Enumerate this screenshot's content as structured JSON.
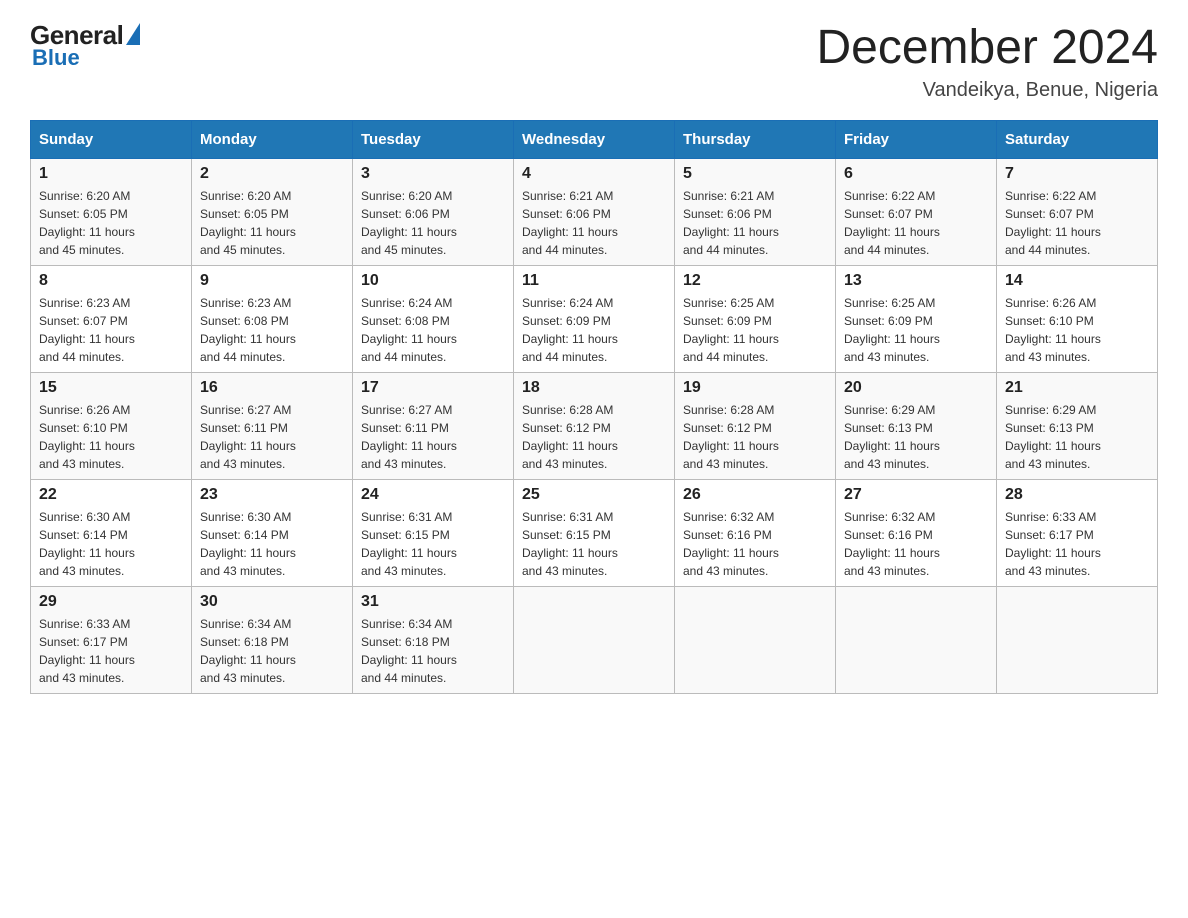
{
  "logo": {
    "general": "General",
    "blue": "Blue"
  },
  "header": {
    "month": "December 2024",
    "location": "Vandeikya, Benue, Nigeria"
  },
  "days_of_week": [
    "Sunday",
    "Monday",
    "Tuesday",
    "Wednesday",
    "Thursday",
    "Friday",
    "Saturday"
  ],
  "weeks": [
    [
      {
        "day": "1",
        "sunrise": "6:20 AM",
        "sunset": "6:05 PM",
        "daylight": "11 hours and 45 minutes."
      },
      {
        "day": "2",
        "sunrise": "6:20 AM",
        "sunset": "6:05 PM",
        "daylight": "11 hours and 45 minutes."
      },
      {
        "day": "3",
        "sunrise": "6:20 AM",
        "sunset": "6:06 PM",
        "daylight": "11 hours and 45 minutes."
      },
      {
        "day": "4",
        "sunrise": "6:21 AM",
        "sunset": "6:06 PM",
        "daylight": "11 hours and 44 minutes."
      },
      {
        "day": "5",
        "sunrise": "6:21 AM",
        "sunset": "6:06 PM",
        "daylight": "11 hours and 44 minutes."
      },
      {
        "day": "6",
        "sunrise": "6:22 AM",
        "sunset": "6:07 PM",
        "daylight": "11 hours and 44 minutes."
      },
      {
        "day": "7",
        "sunrise": "6:22 AM",
        "sunset": "6:07 PM",
        "daylight": "11 hours and 44 minutes."
      }
    ],
    [
      {
        "day": "8",
        "sunrise": "6:23 AM",
        "sunset": "6:07 PM",
        "daylight": "11 hours and 44 minutes."
      },
      {
        "day": "9",
        "sunrise": "6:23 AM",
        "sunset": "6:08 PM",
        "daylight": "11 hours and 44 minutes."
      },
      {
        "day": "10",
        "sunrise": "6:24 AM",
        "sunset": "6:08 PM",
        "daylight": "11 hours and 44 minutes."
      },
      {
        "day": "11",
        "sunrise": "6:24 AM",
        "sunset": "6:09 PM",
        "daylight": "11 hours and 44 minutes."
      },
      {
        "day": "12",
        "sunrise": "6:25 AM",
        "sunset": "6:09 PM",
        "daylight": "11 hours and 44 minutes."
      },
      {
        "day": "13",
        "sunrise": "6:25 AM",
        "sunset": "6:09 PM",
        "daylight": "11 hours and 43 minutes."
      },
      {
        "day": "14",
        "sunrise": "6:26 AM",
        "sunset": "6:10 PM",
        "daylight": "11 hours and 43 minutes."
      }
    ],
    [
      {
        "day": "15",
        "sunrise": "6:26 AM",
        "sunset": "6:10 PM",
        "daylight": "11 hours and 43 minutes."
      },
      {
        "day": "16",
        "sunrise": "6:27 AM",
        "sunset": "6:11 PM",
        "daylight": "11 hours and 43 minutes."
      },
      {
        "day": "17",
        "sunrise": "6:27 AM",
        "sunset": "6:11 PM",
        "daylight": "11 hours and 43 minutes."
      },
      {
        "day": "18",
        "sunrise": "6:28 AM",
        "sunset": "6:12 PM",
        "daylight": "11 hours and 43 minutes."
      },
      {
        "day": "19",
        "sunrise": "6:28 AM",
        "sunset": "6:12 PM",
        "daylight": "11 hours and 43 minutes."
      },
      {
        "day": "20",
        "sunrise": "6:29 AM",
        "sunset": "6:13 PM",
        "daylight": "11 hours and 43 minutes."
      },
      {
        "day": "21",
        "sunrise": "6:29 AM",
        "sunset": "6:13 PM",
        "daylight": "11 hours and 43 minutes."
      }
    ],
    [
      {
        "day": "22",
        "sunrise": "6:30 AM",
        "sunset": "6:14 PM",
        "daylight": "11 hours and 43 minutes."
      },
      {
        "day": "23",
        "sunrise": "6:30 AM",
        "sunset": "6:14 PM",
        "daylight": "11 hours and 43 minutes."
      },
      {
        "day": "24",
        "sunrise": "6:31 AM",
        "sunset": "6:15 PM",
        "daylight": "11 hours and 43 minutes."
      },
      {
        "day": "25",
        "sunrise": "6:31 AM",
        "sunset": "6:15 PM",
        "daylight": "11 hours and 43 minutes."
      },
      {
        "day": "26",
        "sunrise": "6:32 AM",
        "sunset": "6:16 PM",
        "daylight": "11 hours and 43 minutes."
      },
      {
        "day": "27",
        "sunrise": "6:32 AM",
        "sunset": "6:16 PM",
        "daylight": "11 hours and 43 minutes."
      },
      {
        "day": "28",
        "sunrise": "6:33 AM",
        "sunset": "6:17 PM",
        "daylight": "11 hours and 43 minutes."
      }
    ],
    [
      {
        "day": "29",
        "sunrise": "6:33 AM",
        "sunset": "6:17 PM",
        "daylight": "11 hours and 43 minutes."
      },
      {
        "day": "30",
        "sunrise": "6:34 AM",
        "sunset": "6:18 PM",
        "daylight": "11 hours and 43 minutes."
      },
      {
        "day": "31",
        "sunrise": "6:34 AM",
        "sunset": "6:18 PM",
        "daylight": "11 hours and 44 minutes."
      },
      null,
      null,
      null,
      null
    ]
  ],
  "labels": {
    "sunrise": "Sunrise:",
    "sunset": "Sunset:",
    "daylight": "Daylight:"
  }
}
